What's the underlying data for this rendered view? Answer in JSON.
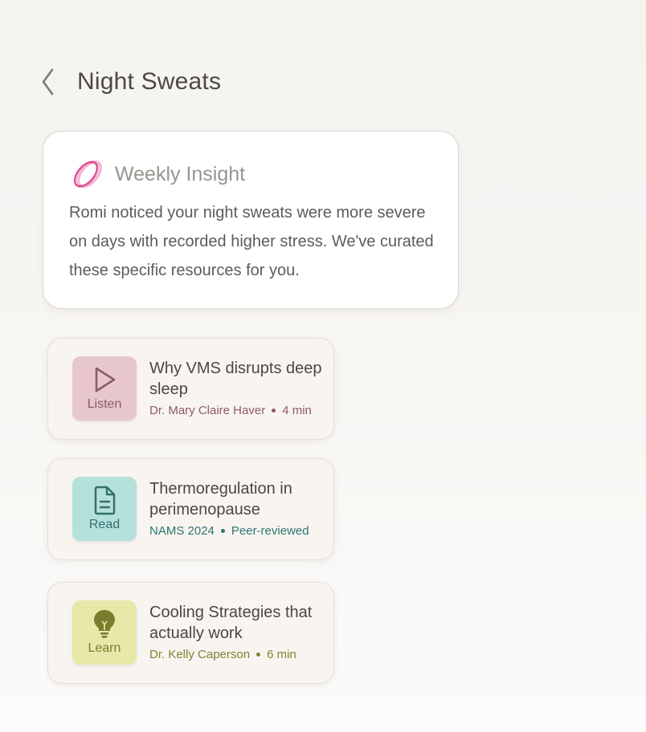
{
  "header": {
    "title": "Night Sweats",
    "back_icon": "chevron-left-icon"
  },
  "insight": {
    "title": "Weekly Insight",
    "logo_icon": "romi-logo-icon",
    "body": "Romi noticed your night sweats were more severe on days with recorded higher stress. We've curated these specific resources for you."
  },
  "resources": [
    {
      "type_label": "Listen",
      "icon": "play-icon",
      "title": "Why VMS disrupts deep sleep",
      "meta_primary": "Dr. Mary Claire Haver",
      "meta_secondary": "4 min",
      "tile_color": "#e7c7cc",
      "accent_color": "#8f5a64"
    },
    {
      "type_label": "Read",
      "icon": "document-icon",
      "title": "Thermoregulation in perimenopause",
      "meta_primary": "NAMS 2024",
      "meta_secondary": "Peer-reviewed",
      "tile_color": "#b5e1dd",
      "accent_color": "#2f7470"
    },
    {
      "type_label": "Learn",
      "icon": "lightbulb-icon",
      "title": "Cooling Strategies that actually work",
      "meta_primary": "Dr. Kelly Caperson",
      "meta_secondary": "6 min",
      "tile_color": "#e8e8a8",
      "accent_color": "#7f8330"
    }
  ]
}
